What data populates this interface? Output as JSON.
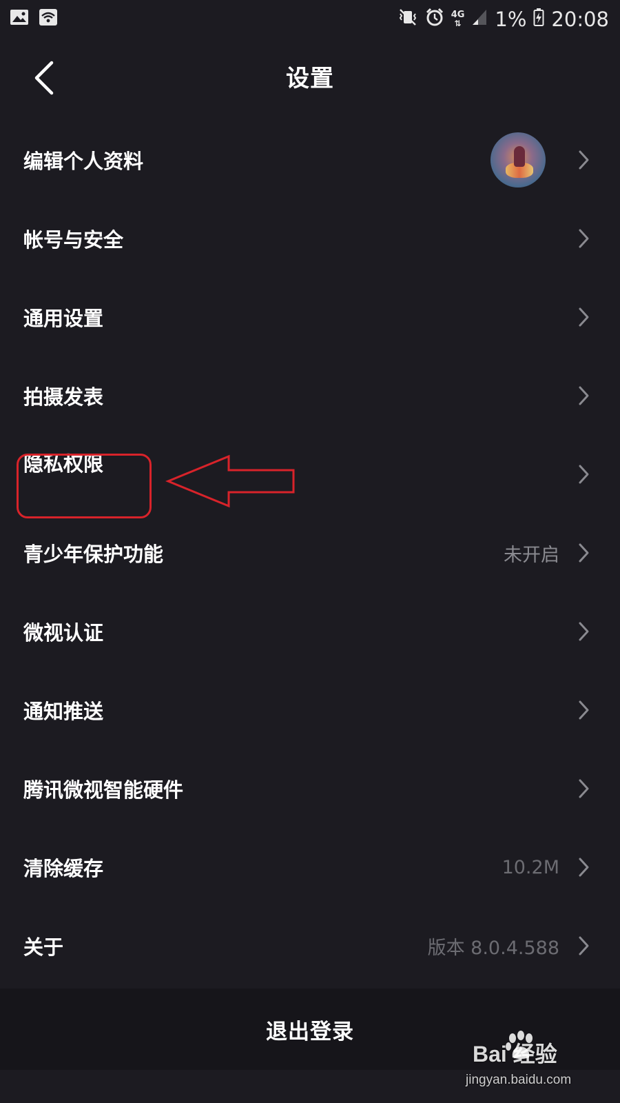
{
  "status_bar": {
    "battery_percent": "1%",
    "time": "20:08",
    "network_type": "4G",
    "icons": [
      "image-icon",
      "wifi-icon",
      "vibrate-icon",
      "alarm-icon",
      "network-4g-icon",
      "signal-icon",
      "battery-charging-icon"
    ]
  },
  "header": {
    "title": "设置",
    "back_icon": "chevron-left-icon"
  },
  "menu": {
    "items": [
      {
        "label": "编辑个人资料",
        "value": "",
        "has_avatar": true
      },
      {
        "label": "帐号与安全",
        "value": ""
      },
      {
        "label": "通用设置",
        "value": ""
      },
      {
        "label": "拍摄发表",
        "value": ""
      },
      {
        "label": "隐私权限",
        "value": ""
      },
      {
        "label": "青少年保护功能",
        "value": "未开启"
      },
      {
        "label": "微视认证",
        "value": ""
      },
      {
        "label": "通知推送",
        "value": ""
      },
      {
        "label": "腾讯微视智能硬件",
        "value": ""
      },
      {
        "label": "清除缓存",
        "value": "10.2M"
      },
      {
        "label": "关于",
        "value": "版本 8.0.4.588"
      }
    ]
  },
  "footer": {
    "logout_label": "退出登录"
  },
  "watermark": {
    "brand": "Bai  经验",
    "url": "jingyan.baidu.com"
  },
  "colors": {
    "background": "#1c1b21",
    "annotation": "#d8232a",
    "secondary_text": "#8a8a90"
  }
}
